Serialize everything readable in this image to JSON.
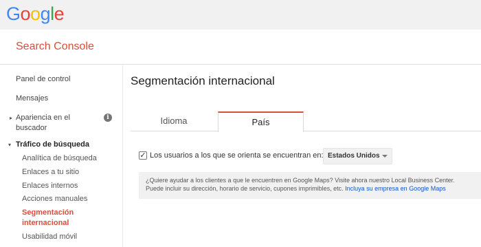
{
  "brand": {
    "logo_letters": [
      {
        "ch": "G",
        "color": "#4285f4"
      },
      {
        "ch": "o",
        "color": "#ea4335"
      },
      {
        "ch": "o",
        "color": "#fbbc05"
      },
      {
        "ch": "g",
        "color": "#4285f4"
      },
      {
        "ch": "l",
        "color": "#34a853"
      },
      {
        "ch": "e",
        "color": "#ea4335"
      }
    ],
    "product": "Search Console"
  },
  "sidebar": {
    "items": [
      {
        "label": "Panel de control"
      },
      {
        "label": "Mensajes"
      },
      {
        "label_line1": "Apariencia en el",
        "label_line2": "buscador"
      },
      {
        "label": "Tráfico de búsqueda"
      },
      {
        "label": "Analítica de búsqueda"
      },
      {
        "label": "Enlaces a tu sitio"
      },
      {
        "label": "Enlaces internos"
      },
      {
        "label": "Acciones manuales"
      },
      {
        "label_line1": "Segmentación",
        "label_line2": "internacional"
      },
      {
        "label": "Usabilidad móvil"
      }
    ]
  },
  "main": {
    "title": "Segmentación internacional",
    "tabs": [
      {
        "label": "Idioma"
      },
      {
        "label": "País"
      }
    ],
    "target": {
      "checked": true,
      "check_glyph": "✓",
      "label": "Los usuarios a los que se orienta se encuentran en:",
      "country": "Estados Unidos"
    },
    "notice": {
      "line1": "¿Quiere ayudar a los clientes a que le encuentren en Google Maps? Visite ahora nuestro Local Business Center.",
      "line2": "Puede incluir su dirección, horario de servicio, cupones imprimibles, etc. ",
      "link": "Incluya su empresa en Google Maps"
    }
  },
  "colors": {
    "accent_red": "#dd4b39",
    "link_blue": "#1155cc"
  }
}
